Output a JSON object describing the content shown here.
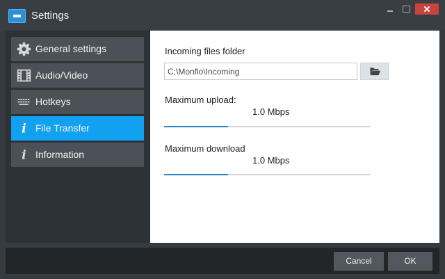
{
  "window": {
    "title": "Settings"
  },
  "sidebar": {
    "items": [
      {
        "label": "General settings",
        "icon": "gear-icon"
      },
      {
        "label": "Audio/Video",
        "icon": "film-icon"
      },
      {
        "label": "Hotkeys",
        "icon": "keyboard-icon"
      },
      {
        "label": "File Transfer",
        "icon": "info-icon",
        "active": true
      },
      {
        "label": "Information",
        "icon": "info-icon"
      }
    ]
  },
  "content": {
    "folder_label": "Incoming files folder",
    "folder_path": "C:\\Monflo\\Incoming",
    "upload_label": "Maximum upload:",
    "upload_value": "1.0 Mbps",
    "upload_level": 0.31,
    "download_label": "Maximum download",
    "download_value": "1.0 Mbps",
    "download_level": 0.31
  },
  "footer": {
    "cancel_label": "Cancel",
    "ok_label": "OK"
  },
  "colors": {
    "accent": "#12a1f0",
    "slider": "#2a86c9",
    "close": "#c7443b"
  }
}
